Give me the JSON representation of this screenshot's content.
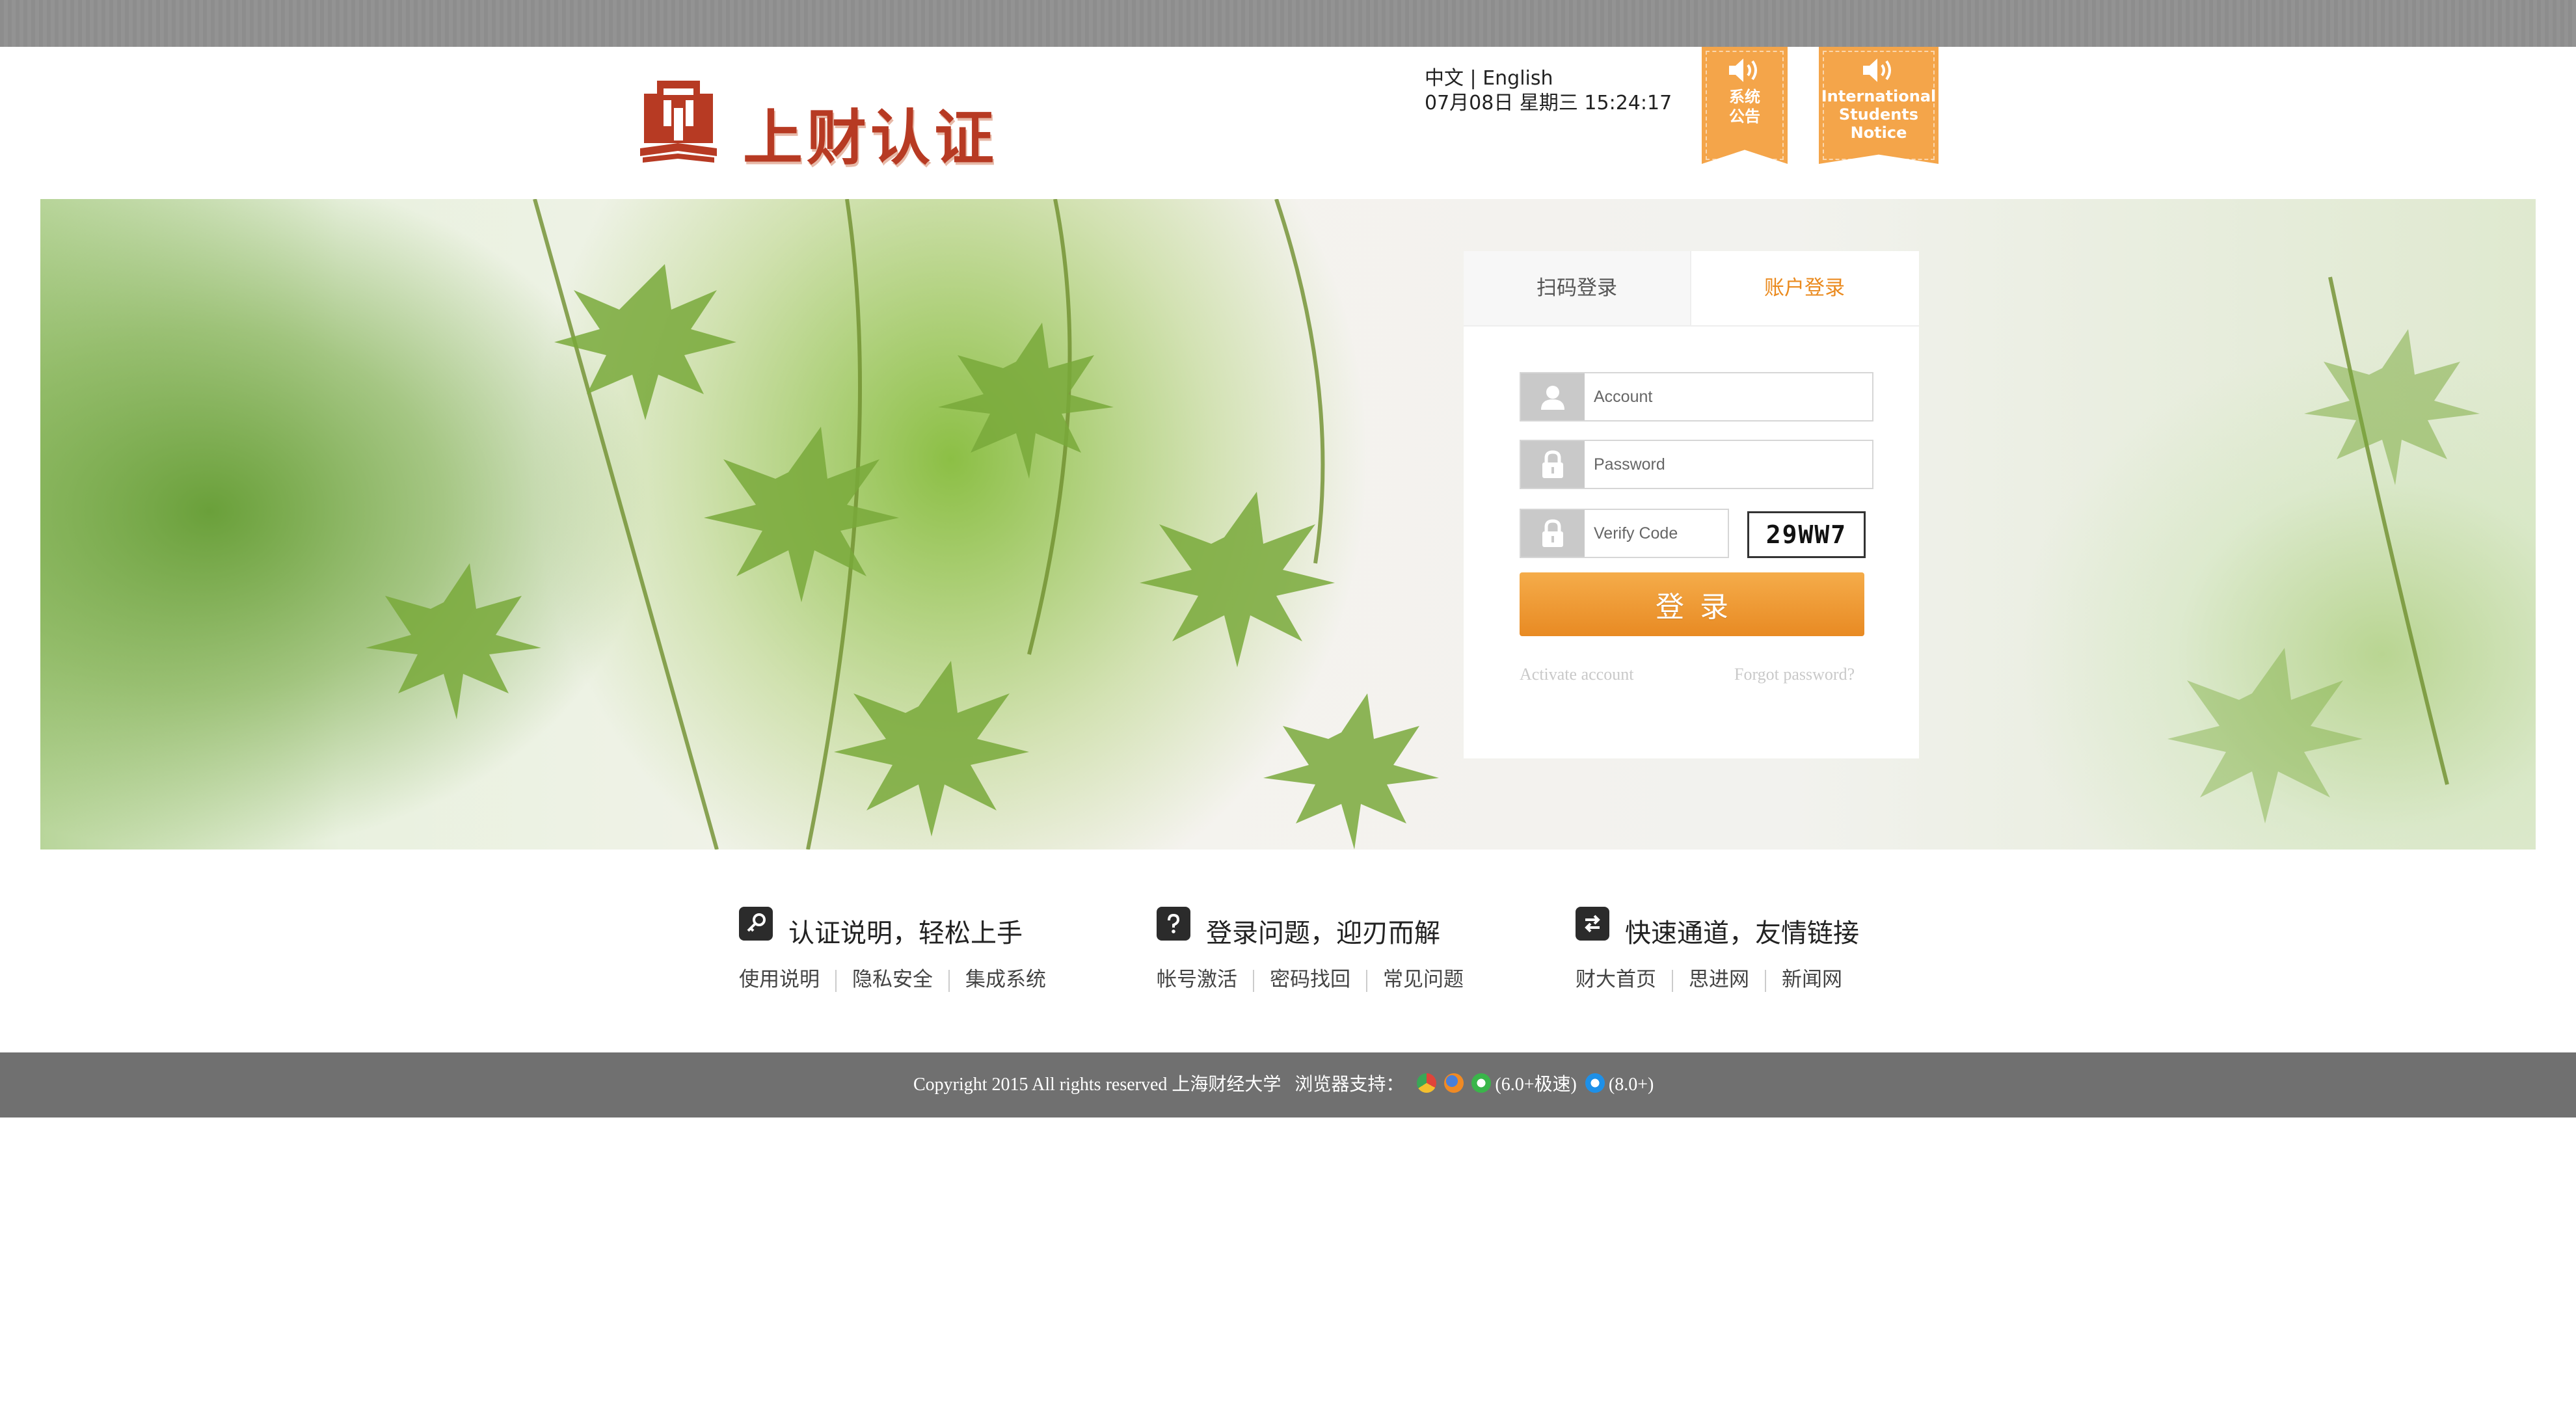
{
  "header": {
    "logo_text": "上财认证",
    "lang_zh": "中文",
    "lang_sep": " | ",
    "lang_en": "English",
    "datetime": "07月08日 星期三 15:24:17",
    "notice_system": [
      "系统",
      "公告"
    ],
    "notice_intl": [
      "International",
      "Students",
      "Notice"
    ]
  },
  "login": {
    "tab_qr": "扫码登录",
    "tab_account": "账户登录",
    "account_placeholder": "Account",
    "password_placeholder": "Password",
    "verify_placeholder": "Verify Code",
    "captcha": "29WW7",
    "submit": "登录",
    "activate": "Activate account",
    "forgot": "Forgot password?"
  },
  "sections": [
    {
      "title": "认证说明，轻松上手",
      "links": [
        "使用说明",
        "隐私安全",
        "集成系统"
      ],
      "icon": "key-icon"
    },
    {
      "title": "登录问题，迎刃而解",
      "links": [
        "帐号激活",
        "密码找回",
        "常见问题"
      ],
      "icon": "question-icon"
    },
    {
      "title": "快速通道，友情链接",
      "links": [
        "财大首页",
        "思进网",
        "新闻网"
      ],
      "icon": "swap-icon"
    }
  ],
  "footer": {
    "copyright": "Copyright 2015 All rights reserved 上海财经大学",
    "browser_label": "浏览器支持：",
    "browser_note_1": "(6.0+极速)",
    "browser_note_2": "(8.0+)"
  },
  "colors": {
    "accent": "#ea8a1e",
    "brand": "#b73a23",
    "notice": "#f4a54a",
    "footer": "#707070"
  }
}
